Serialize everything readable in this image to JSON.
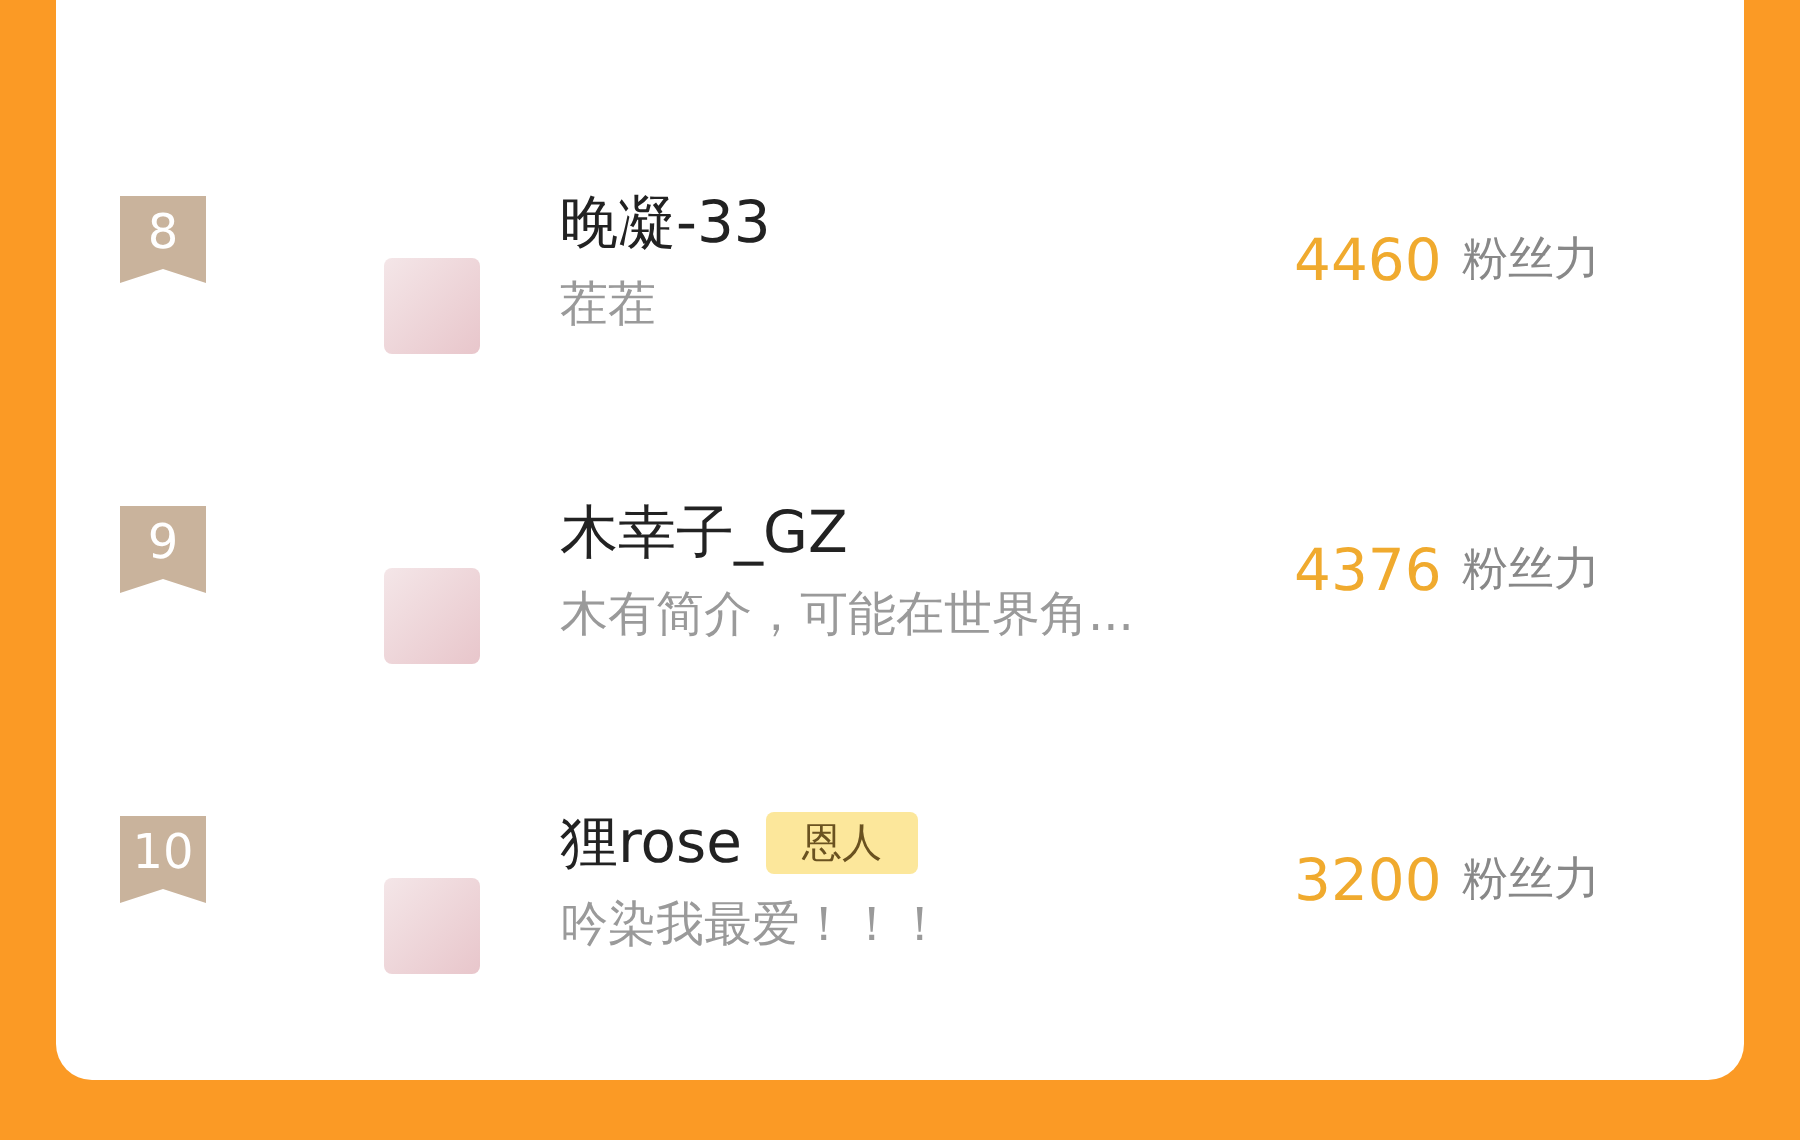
{
  "ranking": [
    {
      "rank": "8",
      "name": "晚凝-33",
      "bio": "茬茬",
      "score": "4460",
      "unit": "粉丝力"
    },
    {
      "rank": "9",
      "name": "木幸子_GZ",
      "bio": "木有简介，可能在世界角...",
      "score": "4376",
      "unit": "粉丝力"
    },
    {
      "rank": "10",
      "name": "狸rose",
      "badge": "恩人",
      "bio": "吟染我最爱！！！",
      "score": "3200",
      "unit": "粉丝力"
    }
  ]
}
